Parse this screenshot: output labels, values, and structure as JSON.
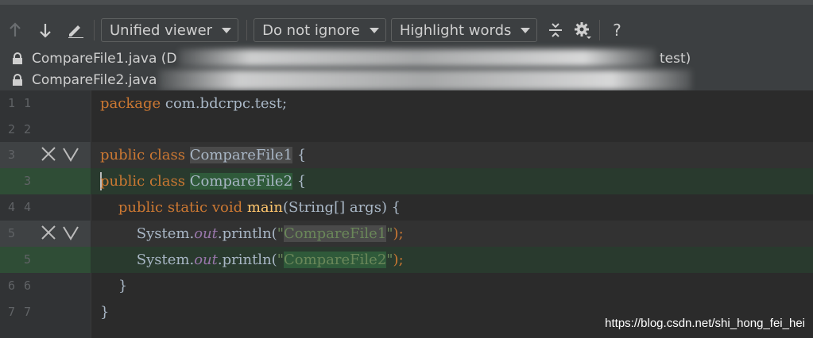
{
  "toolbar": {
    "viewer_select": "Unified viewer",
    "ignore_select": "Do not ignore",
    "highlight_select": "Highlight words",
    "help_label": "?",
    "icons": [
      "arrow-up-icon",
      "arrow-down-icon",
      "edit-icon",
      "collapse-icon",
      "gear-icon"
    ]
  },
  "files": {
    "file1": "CompareFile1.java (D",
    "file1_suffix": "test)",
    "file2": "CompareFile2.java"
  },
  "editor": {
    "rows": [
      {
        "ln1": "1",
        "ln2": "1"
      },
      {
        "ln1": "2",
        "ln2": "2"
      },
      {
        "ln1": "3",
        "ln2": ""
      },
      {
        "ln1": "",
        "ln2": "3"
      },
      {
        "ln1": "4",
        "ln2": "4"
      },
      {
        "ln1": "5",
        "ln2": ""
      },
      {
        "ln1": "",
        "ln2": "5"
      },
      {
        "ln1": "6",
        "ln2": "6"
      },
      {
        "ln1": "7",
        "ln2": "7"
      }
    ],
    "code": {
      "l1_kw": "package",
      "l1_rest": " com.bdcrpc.test;",
      "l3_kw": "public class ",
      "l3_name": "CompareFile1",
      "l3_rest": " {",
      "l3b_kw": "public class ",
      "l3b_name": "CompareFile2",
      "l3b_rest": " {",
      "l4_indent": "    ",
      "l4_kw": "public static void ",
      "l4_fn": "main",
      "l4_rest": "(String[] args) {",
      "l5_indent": "        ",
      "l5_a": "System.",
      "l5_fld": "out",
      "l5_b": ".println(",
      "l5_str_q1": "\"",
      "l5_str_hl": "CompareFile1",
      "l5_str_q2": "\"",
      "l5_end": ");",
      "l5b_str_hl": "CompareFile2",
      "l6": "    }",
      "l7": "}"
    },
    "colors": {
      "keyword": "#cc7832",
      "function": "#ffc66d",
      "field": "#9876aa",
      "string": "#6a8759",
      "deleted_bg": "#323232",
      "inserted_bg": "#293a2e"
    }
  },
  "watermark": "https://blog.csdn.net/shi_hong_fei_hei"
}
